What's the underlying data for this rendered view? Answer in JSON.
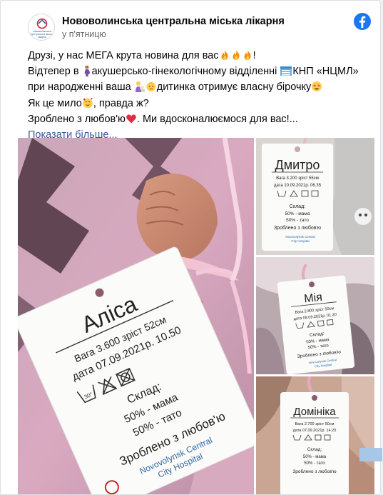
{
  "page": {
    "name": "Нововолинська центральна міська лікарня",
    "time": "у п'ятницю"
  },
  "post": {
    "line1": "Друзі, у нас МЕГА крута новина для вас",
    "line1_end": "!",
    "line2_a": "Відтепер в ",
    "line2_b": "акушерсько-гінекологічному відділенні ",
    "line2_c": "КНП «НЦМЛ»",
    "line3_a": "при народженні ваша ",
    "line3_b": "дитинка отримує власну бірочку",
    "line4_a": "Як це мило",
    "line4_b": ", правда ж?",
    "line5_a": "Зроблено з любов'ю",
    "line5_b": ". Ми вдосконалюємося для вас!...",
    "see_more": "Показати більше..."
  },
  "logo_text": [
    "Нововолинська",
    "центральна міська",
    "лікарня"
  ],
  "tags": {
    "main": {
      "name": "Аліса",
      "weight_height": "Вага 3.600 зріст 52см",
      "date": "дата 07.09.2021р. 10.50",
      "composition_title": "Склад:",
      "mom": "50% - мама",
      "dad": "50% - тато",
      "love": "Зроблено з любов'ю",
      "hospital_1": "Novovolynsk Central",
      "hospital_2": "City Hospital"
    },
    "top_right": {
      "name": "Дмитро",
      "weight_height": "Вага 3.200 зріст 55см",
      "date": "дата 10.09.2021р. 06.35",
      "composition_title": "Склад:",
      "mom": "50% - мама",
      "dad": "50% - тато",
      "love": "Зроблено з любов'ю",
      "hospital_1": "Novovolynsk Central",
      "hospital_2": "City Hospital"
    },
    "middle_right": {
      "name": "Мія",
      "weight_height": "Вага 2.800 зріст 50см",
      "date": "дата 08.09.2021р. 01.20",
      "composition_title": "Склад:",
      "mom": "50% - мама",
      "dad": "50% - тато",
      "love": "Зроблено з любов'ю",
      "hospital_1": "Novovolynsk Central",
      "hospital_2": "City Hospital"
    },
    "bottom_right": {
      "name": "Домініка",
      "weight_height": "Вага 2.700 зріст 50см",
      "date": "дата 07.09.2021р. 14.20",
      "composition_title": "Склад:",
      "mom": "50% - мама",
      "dad": "50% - тато",
      "love": "Зроблено з любов'ю"
    }
  },
  "colors": {
    "link": "#385898",
    "facebook": "#1877f2",
    "pink_blanket": "#d9a7bd",
    "ribbon": "#f3c8d8"
  }
}
